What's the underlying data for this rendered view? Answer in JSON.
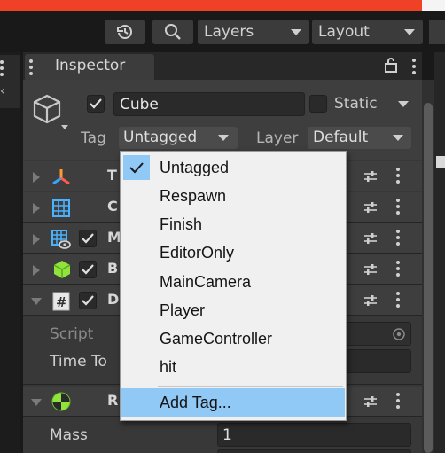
{
  "toolbar": {
    "history_icon": "history-icon",
    "search_icon": "search-icon",
    "layers_label": "Layers",
    "layout_label": "Layout"
  },
  "inspector": {
    "tab_title": "Inspector",
    "object_name": "Cube",
    "static_label": "Static",
    "tag_label": "Tag",
    "tag_value": "Untagged",
    "layer_label": "Layer",
    "layer_value": "Default"
  },
  "components": [
    {
      "letter": "T",
      "icon": "transform-icon"
    },
    {
      "letter": "C",
      "icon": "grid-icon"
    },
    {
      "letter": "M",
      "icon": "mesh-renderer-icon"
    },
    {
      "letter": "B",
      "icon": "box-collider-icon"
    },
    {
      "letter": "D",
      "icon": "script-icon"
    },
    {
      "letter": "R",
      "icon": "rigidbody-icon"
    }
  ],
  "script_component": {
    "script_label": "Script",
    "time_label": "Time To"
  },
  "rigidbody": {
    "mass_label": "Mass",
    "mass_value": "1"
  },
  "tag_menu": {
    "items": [
      "Untagged",
      "Respawn",
      "Finish",
      "EditorOnly",
      "MainCamera",
      "Player",
      "GameController",
      "hit"
    ],
    "add_tag": "Add Tag...",
    "selected": "Untagged"
  },
  "colors": {
    "accent_red": "#ef4126",
    "menu_highlight": "#90c8f6",
    "panel_bg": "#383838"
  }
}
